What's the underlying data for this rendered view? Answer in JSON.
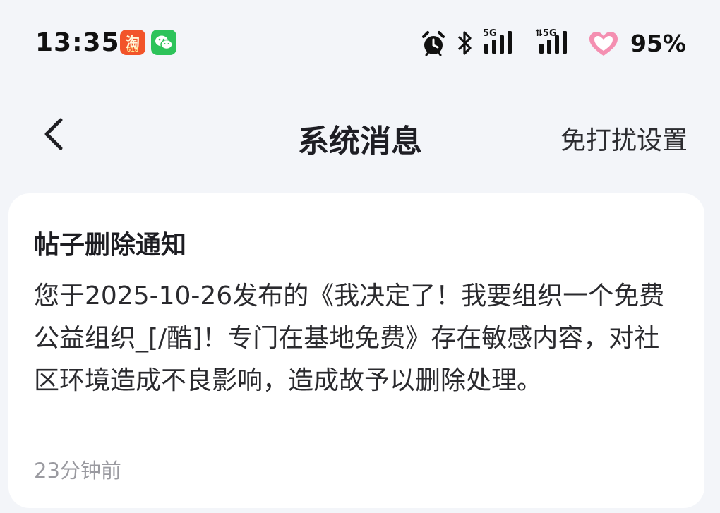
{
  "status_bar": {
    "time": "13:35",
    "apps": [
      {
        "name": "taobao-icon",
        "glyph": "淘",
        "sub": "618",
        "color": "#f2542a"
      },
      {
        "name": "wechat-icon",
        "color": "#2dc35a"
      }
    ],
    "icons": [
      "alarm-icon",
      "bluetooth-icon",
      "signal-5g-icon",
      "signal-5g-data-icon",
      "heart-icon"
    ],
    "network_1": "5G",
    "network_2": "5G",
    "battery": "95%"
  },
  "nav": {
    "title": "系统消息",
    "action_label": "免打扰设置"
  },
  "message": {
    "title": "帖子删除通知",
    "body": "您于2025-10-26发布的《我决定了！我要组织一个免费公益组织_[/酷]！专门在基地免费》存在敏感内容，对社区环境造成不良影响，造成故予以删除处理。",
    "time": "23分钟前"
  },
  "colors": {
    "background": "#f3f5f9",
    "card": "#ffffff",
    "heart": "#f48fb1"
  }
}
